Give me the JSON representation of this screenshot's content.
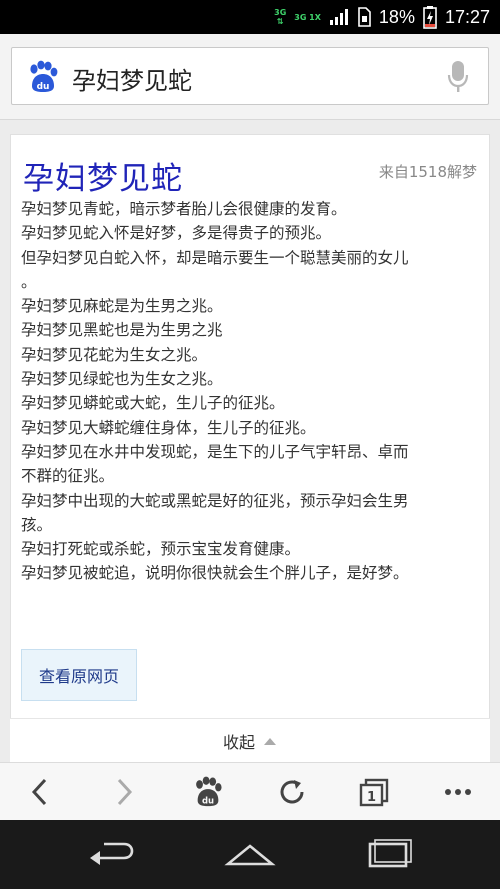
{
  "status_bar": {
    "network1": "3G",
    "network2": "3G 1X",
    "battery": "18%",
    "time": "17:27"
  },
  "search": {
    "query": "孕妇梦见蛇",
    "logo_icon": "baidu-paw-icon",
    "mic_icon": "microphone-icon"
  },
  "result": {
    "title": "孕妇梦见蛇",
    "source": "来自1518解梦",
    "lines": [
      "孕妇梦见青蛇，暗示梦者胎儿会很健康的发育。",
      "孕妇梦见蛇入怀是好梦，多是得贵子的预兆。",
      "但孕妇梦见白蛇入怀，却是暗示要生一个聪慧美丽的女儿",
      "。",
      "孕妇梦见麻蛇是为生男之兆。",
      "孕妇梦见黑蛇也是为生男之兆",
      "孕妇梦见花蛇为生女之兆。",
      "孕妇梦见绿蛇也为生女之兆。",
      "孕妇梦见蟒蛇或大蛇，生儿子的征兆。",
      "孕妇梦见大蟒蛇缠住身体，生儿子的征兆。",
      "孕妇梦见在水井中发现蛇，是生下的儿子气宇轩昂、卓而",
      "不群的征兆。",
      "孕妇梦中出现的大蛇或黑蛇是好的征兆，预示孕妇会生男",
      "孩。",
      "孕妇打死蛇或杀蛇，预示宝宝发育健康。",
      "孕妇梦见被蛇追，说明你很快就会生个胖儿子，是好梦。"
    ],
    "view_original_label": "查看原网页",
    "collapse_label": "收起"
  },
  "toolbar": {
    "tab_count": "1",
    "icons": [
      "back-icon",
      "forward-icon",
      "baidu-home-icon",
      "refresh-icon",
      "tabs-icon",
      "more-icon"
    ]
  },
  "colors": {
    "title": "#2024b8",
    "baidu_blue": "#2b59d9",
    "button_bg": "#eaf4fb"
  }
}
